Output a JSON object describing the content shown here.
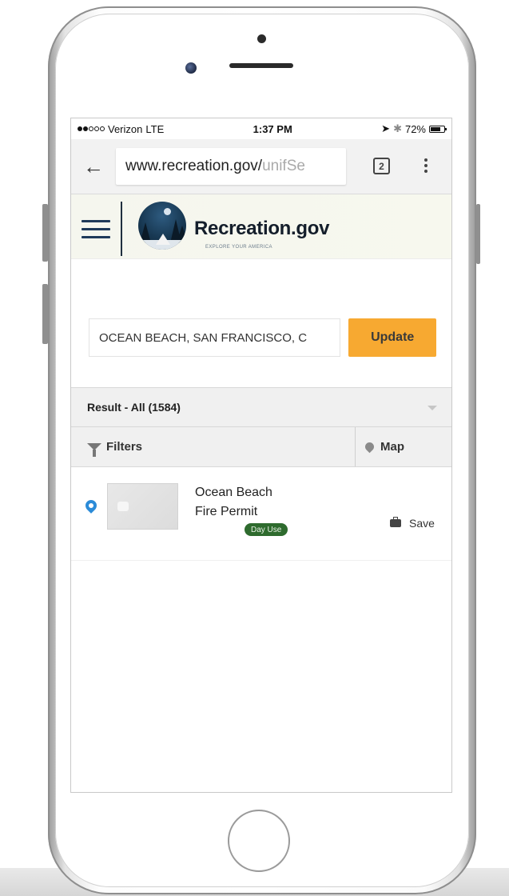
{
  "status_bar": {
    "carrier": "Verizon",
    "network": "LTE",
    "time": "1:37 PM",
    "battery": "72%",
    "battery_level": 0.72,
    "signal_bars_filled": 2,
    "signal_bars_total": 5
  },
  "browser": {
    "url_host": "www.recreation.gov/",
    "url_path": "unifSe",
    "tab_count": "2"
  },
  "site": {
    "brand": "Recreation.gov",
    "tagline": "EXPLORE YOUR AMERICA"
  },
  "search": {
    "value": "OCEAN BEACH, SAN FRANCISCO, C",
    "update_label": "Update"
  },
  "results": {
    "summary": "Result - All (1584)",
    "filters_label": "Filters",
    "map_label": "Map"
  },
  "listing": {
    "title_line1": "Ocean Beach",
    "title_line2": "Fire Permit",
    "badge": "Day Use",
    "save_label": "Save"
  },
  "colors": {
    "update_button": "#f7a931",
    "day_use_badge": "#2e6b2e",
    "location_pin": "#2b8bd8",
    "brand_navy": "#1f3a5a"
  }
}
